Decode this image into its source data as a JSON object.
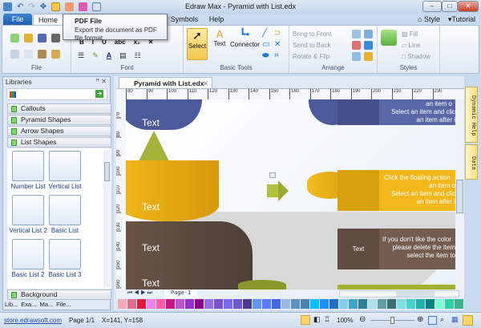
{
  "window": {
    "title": "Edraw Max - Pyramid with List.edx"
  },
  "tabs": [
    "File",
    "Home",
    "Symbols",
    "Help"
  ],
  "right_links": {
    "style": "Style",
    "tutorial": "Tutorial"
  },
  "tooltip": {
    "title": "PDF File",
    "body": "Export the document as PDF file format."
  },
  "ribbon": {
    "groups": [
      "File",
      "Font",
      "Basic Tools",
      "Arrange",
      "Styles"
    ],
    "basic_tools": {
      "select": "Select",
      "text": "Text",
      "connector": "Connector"
    },
    "arrange": [
      "Bring to Front",
      "Send to Back",
      "Rotate & Flip"
    ],
    "styles": [
      "Fill",
      "Line",
      "Shadow"
    ]
  },
  "libraries": {
    "title": "Libraries",
    "categories": [
      "Callouts",
      "Pyramid Shapes",
      "Arrow Shapes",
      "List Shapes"
    ],
    "shapes": [
      "Number List",
      "Vertical List",
      "Vertical List 2",
      "Basic List",
      "Basic List 2",
      "Basic List 3"
    ],
    "bottom_category": "Background",
    "bottom_tabs": [
      "Lib...",
      "Exa...",
      "Ma...",
      "File..."
    ]
  },
  "document": {
    "tab": "Pyramid with List.edx",
    "ruler_top": [
      "80",
      "90",
      "100",
      "110",
      "120",
      "130",
      "140",
      "150",
      "160",
      "170",
      "180",
      "190",
      "200",
      "210",
      "220",
      "230"
    ],
    "ruler_left": [
      "70",
      "80",
      "90",
      "100",
      "110",
      "120",
      "130",
      "140",
      "150",
      "160"
    ],
    "page_tab": "Page-1",
    "pyramid_labels": [
      "Text",
      "Text",
      "Text",
      "Text"
    ],
    "list_box_blue": [
      "an item o",
      "Select an item and clic",
      "an item after i"
    ],
    "list_box_yellow": [
      "Click the floating action",
      "an item o",
      "Select an item and clic",
      "an item after i"
    ],
    "list_box_brown_label": "Text",
    "list_box_brown": [
      "If you don't like the color",
      "please delete the item",
      "select the item to"
    ]
  },
  "side_tabs": [
    "Dynamic Help",
    "Data"
  ],
  "palette": [
    "#f7a8b8",
    "#db6f8f",
    "#e0173f",
    "#ee82ee",
    "#ff5fa8",
    "#c71585",
    "#ba55d3",
    "#9932cc",
    "#8b008b",
    "#9370db",
    "#7a4fd0",
    "#7b68ee",
    "#6a5acd",
    "#483d8b",
    "#6495ed",
    "#5a7bff",
    "#4169e1",
    "#9fb6e8",
    "#5f8fbf",
    "#4682b4",
    "#00bfff",
    "#1e90ff",
    "#1e6fbf",
    "#87ceeb",
    "#3fa7c4",
    "#2e7f97",
    "#b0dde8",
    "#5f9ea0",
    "#3e6f6f",
    "#7fdede",
    "#48d1cc",
    "#20b2aa",
    "#008080",
    "#7fffd4",
    "#2ed1a0",
    "#3cb38a",
    "#66cdaa",
    "#3cb371",
    "#2e8b57",
    "#00ff7f",
    "#00a550",
    "#90ee90"
  ],
  "status": {
    "link": "store.edrawsoft.com",
    "page": "Page 1/1",
    "coords": "X=141, Y=158",
    "zoom": "100%"
  }
}
